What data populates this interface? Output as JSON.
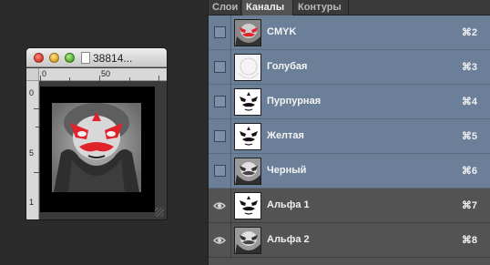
{
  "document": {
    "title": "38814...",
    "ruler_marks_top": [
      "0",
      "50"
    ],
    "ruler_marks_left": [
      "0",
      "5",
      "1"
    ]
  },
  "panel": {
    "tabs": [
      {
        "label": "Слои",
        "active": false
      },
      {
        "label": "Каналы",
        "active": true
      },
      {
        "label": "Контуры",
        "active": false
      }
    ],
    "channels": [
      {
        "name": "CMYK",
        "shortcut": "⌘2",
        "selected": true,
        "visibility": "checkbox",
        "thumb": "color"
      },
      {
        "name": "Голубая",
        "shortcut": "⌘3",
        "selected": true,
        "visibility": "checkbox",
        "thumb": "light"
      },
      {
        "name": "Пурпурная",
        "shortcut": "⌘4",
        "selected": true,
        "visibility": "checkbox",
        "thumb": "mask"
      },
      {
        "name": "Желтая",
        "shortcut": "⌘5",
        "selected": true,
        "visibility": "checkbox",
        "thumb": "mask"
      },
      {
        "name": "Черный",
        "shortcut": "⌘6",
        "selected": true,
        "visibility": "checkbox",
        "thumb": "gray"
      },
      {
        "name": "Альфа 1",
        "shortcut": "⌘7",
        "selected": false,
        "visibility": "eye",
        "thumb": "mask"
      },
      {
        "name": "Альфа 2",
        "shortcut": "⌘8",
        "selected": false,
        "visibility": "eye",
        "thumb": "gray"
      }
    ]
  },
  "colors": {
    "selected_row": "#6c7f99",
    "panel_bg": "#535353",
    "mask_red": "#e0222a"
  }
}
